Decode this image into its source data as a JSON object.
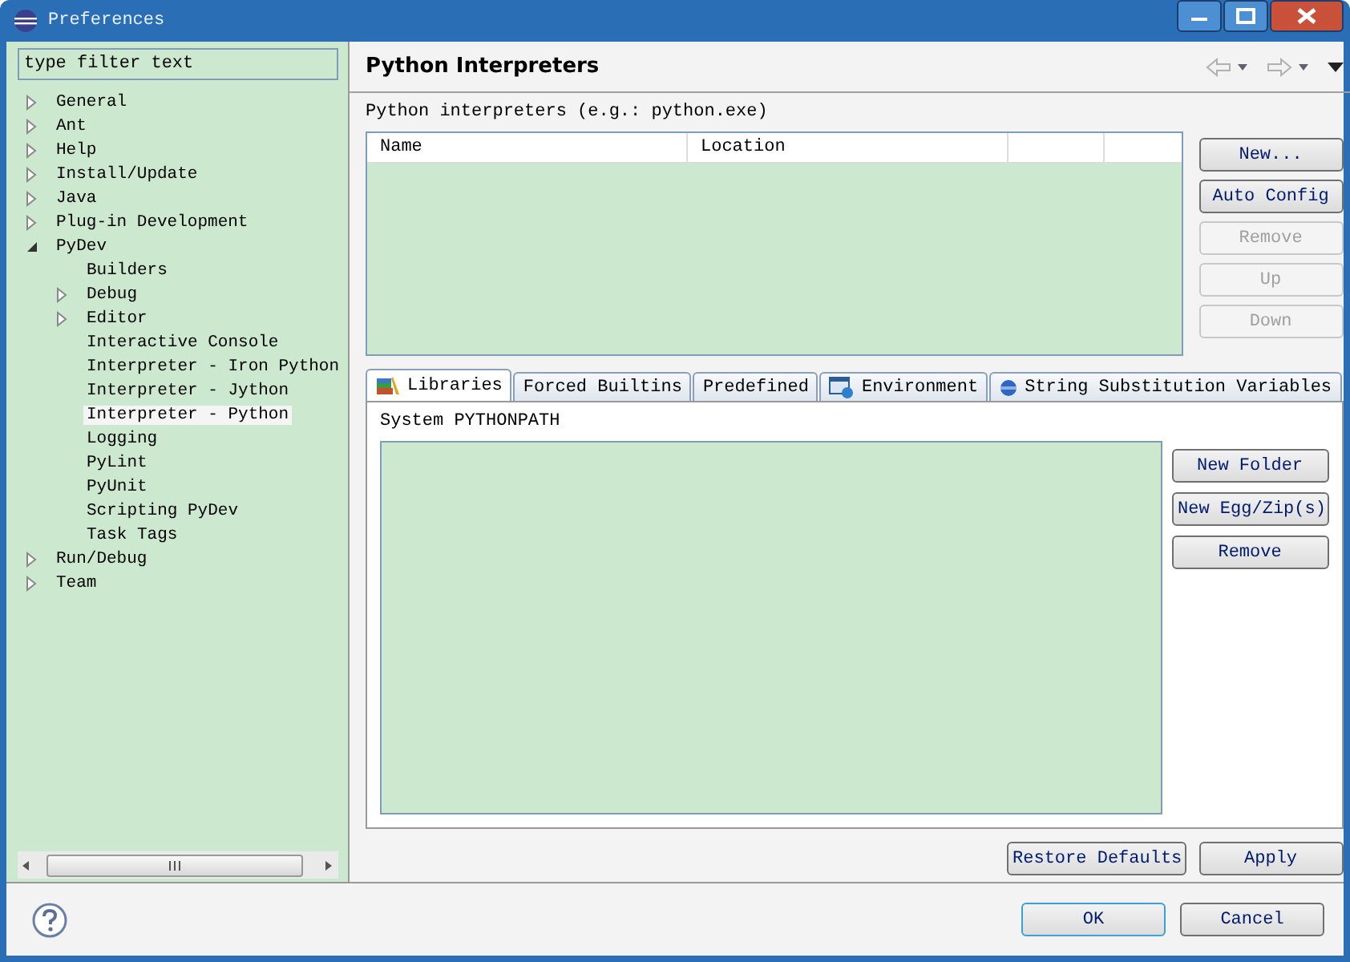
{
  "window": {
    "title": "Preferences"
  },
  "filter": {
    "placeholder": "type filter text"
  },
  "tree": [
    {
      "label": "General",
      "expanded": false,
      "selected": false
    },
    {
      "label": "Ant",
      "expanded": false,
      "selected": false
    },
    {
      "label": "Help",
      "expanded": false,
      "selected": false
    },
    {
      "label": "Install/Update",
      "expanded": false,
      "selected": false
    },
    {
      "label": "Java",
      "expanded": false,
      "selected": false
    },
    {
      "label": "Plug-in Development",
      "expanded": false,
      "selected": false
    },
    {
      "label": "PyDev",
      "expanded": true,
      "selected": false,
      "children": [
        {
          "label": "Builders",
          "selected": false
        },
        {
          "label": "Debug",
          "expanded": false,
          "selected": false
        },
        {
          "label": "Editor",
          "expanded": false,
          "selected": false
        },
        {
          "label": "Interactive Console",
          "selected": false
        },
        {
          "label": "Interpreter - Iron Python",
          "selected": false
        },
        {
          "label": "Interpreter - Jython",
          "selected": false
        },
        {
          "label": "Interpreter - Python",
          "selected": true
        },
        {
          "label": "Logging",
          "selected": false
        },
        {
          "label": "PyLint",
          "selected": false
        },
        {
          "label": "PyUnit",
          "selected": false
        },
        {
          "label": "Scripting PyDev",
          "selected": false
        },
        {
          "label": "Task Tags",
          "selected": false
        }
      ]
    },
    {
      "label": "Run/Debug",
      "expanded": false,
      "selected": false
    },
    {
      "label": "Team",
      "expanded": false,
      "selected": false
    }
  ],
  "page": {
    "title": "Python Interpreters",
    "label": "Python interpreters (e.g.: python.exe)",
    "columns": [
      "Name",
      "Location"
    ],
    "buttons": [
      {
        "label": "New...",
        "disabled": false
      },
      {
        "label": "Auto Config",
        "disabled": false
      },
      {
        "label": "Remove",
        "disabled": true
      },
      {
        "label": "Up",
        "disabled": true
      },
      {
        "label": "Down",
        "disabled": true
      }
    ],
    "tabs": [
      {
        "label": "Libraries",
        "kind": "books",
        "selected": true
      },
      {
        "label": "Forced Builtins",
        "kind": "plain",
        "selected": false
      },
      {
        "label": "Predefined",
        "kind": "plain",
        "selected": false
      },
      {
        "label": "Environment",
        "kind": "environment",
        "selected": false
      },
      {
        "label": "String Substitution Variables",
        "kind": "variables",
        "selected": false
      }
    ],
    "libraries": {
      "label": "System PYTHONPATH",
      "buttons": [
        {
          "label": "New Folder",
          "disabled": false
        },
        {
          "label": "New Egg/Zip(s)",
          "disabled": false
        },
        {
          "label": "Remove",
          "disabled": false
        }
      ]
    },
    "actions": [
      {
        "label": "Restore Defaults",
        "disabled": false
      },
      {
        "label": "Apply",
        "disabled": false
      }
    ]
  },
  "footer": {
    "buttons": [
      {
        "label": "OK",
        "default": true
      },
      {
        "label": "Cancel",
        "default": false
      }
    ]
  }
}
